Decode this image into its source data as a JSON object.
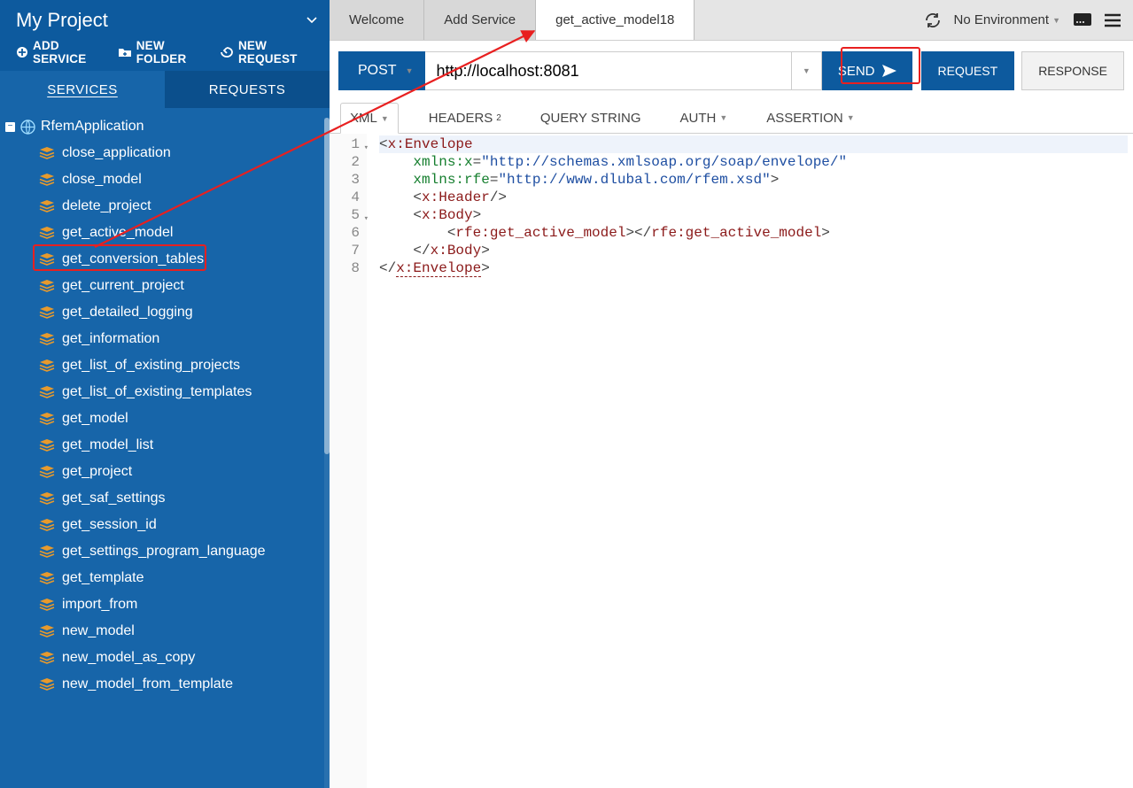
{
  "project": {
    "title": "My Project",
    "actions": {
      "add_service": "ADD SERVICE",
      "new_folder": "NEW FOLDER",
      "new_request": "NEW REQUEST"
    }
  },
  "sidebar_tabs": {
    "services": "SERVICES",
    "requests": "REQUESTS"
  },
  "tree": {
    "root": "RfemApplication",
    "items": [
      "close_application",
      "close_model",
      "delete_project",
      "get_active_model",
      "get_conversion_tables",
      "get_current_project",
      "get_detailed_logging",
      "get_information",
      "get_list_of_existing_projects",
      "get_list_of_existing_templates",
      "get_model",
      "get_model_list",
      "get_project",
      "get_saf_settings",
      "get_session_id",
      "get_settings_program_language",
      "get_template",
      "import_from",
      "new_model",
      "new_model_as_copy",
      "new_model_from_template"
    ],
    "highlighted_index": 3
  },
  "main_tabs": [
    {
      "label": "Welcome",
      "active": false
    },
    {
      "label": "Add Service",
      "active": false
    },
    {
      "label": "get_active_model18",
      "active": true
    }
  ],
  "environment": "No Environment",
  "request": {
    "method": "POST",
    "url": "http://localhost:8081",
    "send": "SEND"
  },
  "view_tabs": {
    "request": "REQUEST",
    "response": "RESPONSE",
    "active": "request"
  },
  "content_tabs": {
    "xml": "XML",
    "headers": "HEADERS",
    "headers_badge": "2",
    "query": "QUERY STRING",
    "auth": "AUTH",
    "assertion": "ASSERTION",
    "active": "xml"
  },
  "editor": {
    "lines": [
      {
        "n": 1,
        "fold": true,
        "html": "<span class=\"p\">&lt;</span><span class=\"t\">x:Envelope</span>"
      },
      {
        "n": 2,
        "html": "    <span class=\"a\">xmlns:x</span><span class=\"p\">=</span><span class=\"s\">\"http://schemas.xmlsoap.org/soap/envelope/\"</span>"
      },
      {
        "n": 3,
        "html": "    <span class=\"a\">xmlns:rfe</span><span class=\"p\">=</span><span class=\"s\">\"http://www.dlubal.com/rfem.xsd\"</span><span class=\"p\">&gt;</span>"
      },
      {
        "n": 4,
        "html": "    <span class=\"p\">&lt;</span><span class=\"t\">x:Header</span><span class=\"p\">/&gt;</span>"
      },
      {
        "n": 5,
        "fold": true,
        "html": "    <span class=\"p\">&lt;</span><span class=\"t\">x:Body</span><span class=\"p\">&gt;</span>"
      },
      {
        "n": 6,
        "html": "        <span class=\"p\">&lt;</span><span class=\"t\">rfe:get_active_model</span><span class=\"p\">&gt;&lt;/</span><span class=\"t\">rfe:get_active_model</span><span class=\"p\">&gt;</span>"
      },
      {
        "n": 7,
        "html": "    <span class=\"p\">&lt;/</span><span class=\"t\">x:Body</span><span class=\"p\">&gt;</span>"
      },
      {
        "n": 8,
        "html": "<span class=\"p\">&lt;/</span><span class=\"t\" style=\"border-bottom:1px dashed #8b1a1a\">x:Envelope</span><span class=\"p\">&gt;</span>"
      }
    ]
  }
}
